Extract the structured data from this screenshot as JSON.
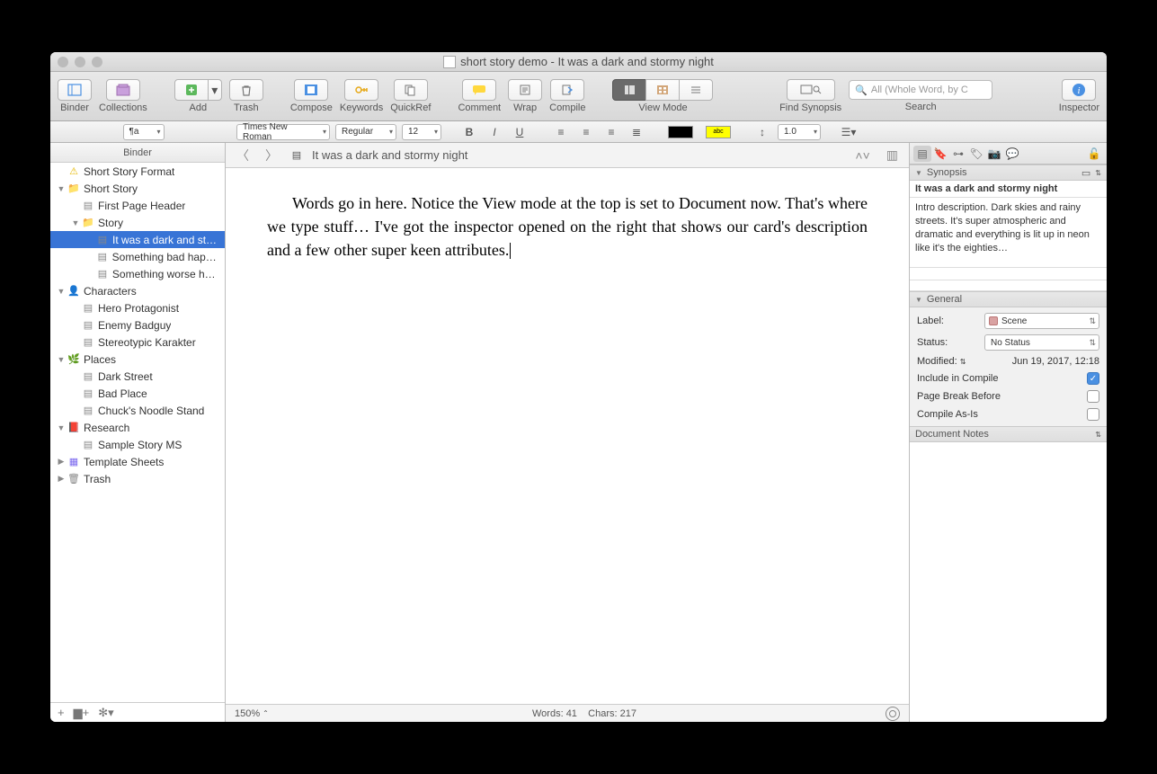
{
  "window": {
    "title": "short story demo - It was a dark and stormy night"
  },
  "toolbar": {
    "binder": "Binder",
    "collections": "Collections",
    "add": "Add",
    "trash": "Trash",
    "compose": "Compose",
    "keywords": "Keywords",
    "quickref": "QuickRef",
    "comment": "Comment",
    "wrap": "Wrap",
    "compile": "Compile",
    "viewmode": "View Mode",
    "findsyn": "Find Synopsis",
    "search": "Search",
    "inspector": "Inspector",
    "search_placeholder": "All (Whole Word, by C"
  },
  "format": {
    "style": "¶a",
    "font": "Times New Roman",
    "weight": "Regular",
    "size": "12",
    "spacing": "1.0"
  },
  "binder": {
    "header": "Binder",
    "items": [
      {
        "depth": 0,
        "disc": "",
        "icon": "warn",
        "label": "Short Story Format"
      },
      {
        "depth": 0,
        "disc": "▼",
        "icon": "folder",
        "label": "Short Story"
      },
      {
        "depth": 1,
        "disc": "",
        "icon": "doc",
        "label": "First Page Header"
      },
      {
        "depth": 1,
        "disc": "▼",
        "icon": "folder",
        "label": "Story"
      },
      {
        "depth": 2,
        "disc": "",
        "icon": "doc",
        "label": "It was a dark and st…",
        "selected": true
      },
      {
        "depth": 2,
        "disc": "",
        "icon": "doc",
        "label": "Something bad happ…"
      },
      {
        "depth": 2,
        "disc": "",
        "icon": "doc",
        "label": "Something worse ha…"
      },
      {
        "depth": 0,
        "disc": "▼",
        "icon": "char",
        "label": "Characters"
      },
      {
        "depth": 1,
        "disc": "",
        "icon": "doc",
        "label": "Hero Protagonist"
      },
      {
        "depth": 1,
        "disc": "",
        "icon": "doc",
        "label": "Enemy Badguy"
      },
      {
        "depth": 1,
        "disc": "",
        "icon": "doc",
        "label": "Stereotypic Karakter"
      },
      {
        "depth": 0,
        "disc": "▼",
        "icon": "place",
        "label": "Places"
      },
      {
        "depth": 1,
        "disc": "",
        "icon": "doc",
        "label": "Dark Street"
      },
      {
        "depth": 1,
        "disc": "",
        "icon": "doc",
        "label": "Bad Place"
      },
      {
        "depth": 1,
        "disc": "",
        "icon": "doc",
        "label": "Chuck's Noodle Stand"
      },
      {
        "depth": 0,
        "disc": "▼",
        "icon": "research",
        "label": "Research"
      },
      {
        "depth": 1,
        "disc": "",
        "icon": "doc",
        "label": "Sample Story MS"
      },
      {
        "depth": 0,
        "disc": "▶",
        "icon": "tmpl",
        "label": "Template Sheets"
      },
      {
        "depth": 0,
        "disc": "▶",
        "icon": "trash",
        "label": "Trash"
      }
    ]
  },
  "path": {
    "doc": "It was a dark and stormy night"
  },
  "editor": {
    "body": "Words go in here. Notice the View mode at the top is set to Document now. That's where we type stuff… I've got the inspector opened on the right that shows our card's description and a few other super keen attributes."
  },
  "status": {
    "zoom": "150%",
    "words": "Words: 41",
    "chars": "Chars: 217"
  },
  "inspector": {
    "synopsis_h": "Synopsis",
    "syn_title": "It was a dark and stormy night",
    "syn_body": "Intro description. Dark skies and rainy streets. It's super atmospheric and dramatic and everything is lit up in neon like it's the eighties…",
    "general_h": "General",
    "label_lbl": "Label:",
    "label_val": "Scene",
    "status_lbl": "Status:",
    "status_val": "No Status",
    "modified_lbl": "Modified:",
    "modified_val": "Jun 19, 2017, 12:18",
    "include": "Include in Compile",
    "pbb": "Page Break Before",
    "asis": "Compile As-Is",
    "notes_h": "Document Notes"
  }
}
